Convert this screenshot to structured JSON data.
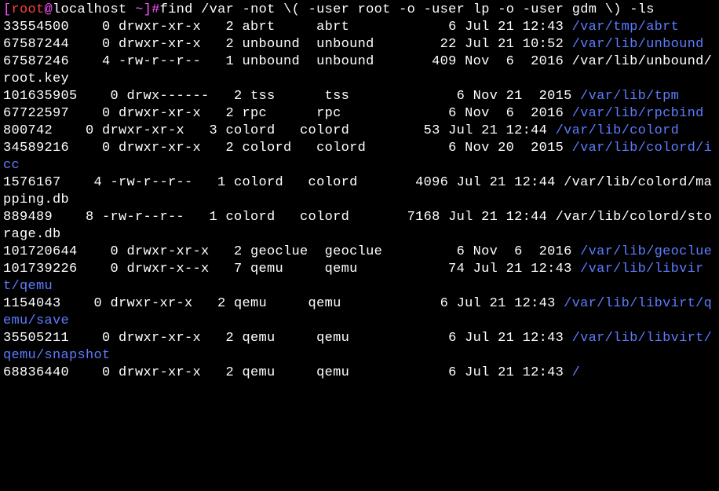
{
  "prompt": {
    "open_bracket": "[",
    "user": "root",
    "at": "@",
    "host": "localhost",
    "space": " ",
    "path": "~",
    "close": "]",
    "hash": "#"
  },
  "command": "find /var -not \\( -user root -o -user lp -o -user gdm \\) -ls",
  "out": {
    "l1": "33554500    0 drwxr-xr-x   2 abrt     abrt            6 Jul 21 12:43 /var/tmp/abrt",
    "l2": "67587244    0 drwxr-xr-x   2 unbound  unbound        22 Jul 21 10:52 /var/lib/unbound",
    "l3": "67587246    4 -rw-r--r--   1 unbound  unbound       409 Nov  6  2016 /var/lib/unbound/root.key",
    "l4": "101635905    0 drwx------   2 tss      tss             6 Nov 21  2015 /var/lib/tpm",
    "l5": "67722597    0 drwxr-xr-x   2 rpc      rpc             6 Nov  6  2016 /var/lib/rpcbind",
    "l6": "800742    0 drwxr-xr-x   3 colord   colord         53 Jul 21 12:44 /var/lib/colord",
    "l7": "34589216    0 drwxr-xr-x   2 colord   colord          6 Nov 20  2015 /var/lib/colord/icc",
    "l8": "1576167    4 -rw-r--r--   1 colord   colord       4096 Jul 21 12:44 /var/lib/colord/mapping.db",
    "l9": "889489    8 -rw-r--r--   1 colord   colord       7168 Jul 21 12:44 /var/lib/colord/storage.db",
    "l10": "101720644    0 drwxr-xr-x   2 geoclue  geoclue         6 Nov  6  2016 /var/lib/geoclue",
    "l11": "101739226    0 drwxr-x--x   7 qemu     qemu           74 Jul 21 12:43 /var/lib/libvirt/qemu",
    "l12": "1154043    0 drwxr-xr-x   2 qemu     qemu            6 Jul 21 12:43 /var/lib/libvirt/qemu/save",
    "l13": "35505211    0 drwxr-xr-x   2 qemu     qemu            6 Jul 21 12:43 /var/lib/libvirt/qemu/snapshot",
    "l14": "68836440    0 drwxr-xr-x   2 qemu     qemu            6 Jul 21 12:43 /"
  }
}
